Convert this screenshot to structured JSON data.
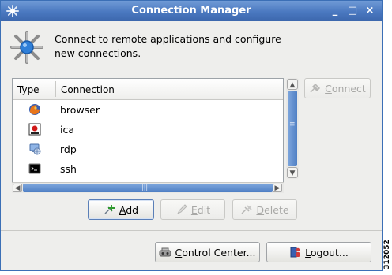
{
  "window": {
    "title": "Connection Manager"
  },
  "titlebar": {
    "minimize": "_",
    "maximize": "□",
    "close": "×"
  },
  "header": {
    "description": "Connect to remote applications and configure new connections."
  },
  "list": {
    "columns": [
      "Type",
      "Connection"
    ],
    "rows": [
      {
        "label": "browser",
        "icon": "firefox-icon"
      },
      {
        "label": "ica",
        "icon": "ica-icon"
      },
      {
        "label": "rdp",
        "icon": "rdp-icon"
      },
      {
        "label": "ssh",
        "icon": "terminal-icon"
      }
    ]
  },
  "buttons": {
    "connect": {
      "label": "Connect",
      "state": "disabled"
    },
    "add": {
      "label": "Add",
      "state": "enabled"
    },
    "edit": {
      "label": "Edit",
      "state": "disabled"
    },
    "delete": {
      "label": "Delete",
      "state": "disabled"
    },
    "control_center": {
      "label": "Control Center...",
      "state": "enabled"
    },
    "logout": {
      "label": "Logout...",
      "state": "enabled"
    }
  },
  "figure_id": "312052",
  "colors": {
    "titlebar": "#4a78c0",
    "scroll_thumb": "#4f7fc4",
    "window_bg": "#eeeeec"
  }
}
